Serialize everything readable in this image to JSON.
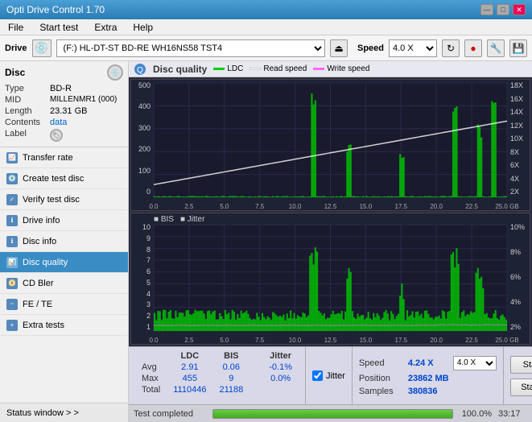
{
  "titleBar": {
    "title": "Opti Drive Control 1.70",
    "minBtn": "—",
    "maxBtn": "□",
    "closeBtn": "✕"
  },
  "menuBar": {
    "items": [
      "File",
      "Start test",
      "Extra",
      "Help"
    ]
  },
  "toolbar": {
    "driveLabel": "Drive",
    "driveName": "(F:)  HL-DT-ST BD-RE  WH16NS58 TST4",
    "speedLabel": "Speed",
    "speedValue": "4.0 X"
  },
  "disc": {
    "label": "Disc",
    "type": {
      "key": "Type",
      "val": "BD-R"
    },
    "mid": {
      "key": "MID",
      "val": "MILLENMR1 (000)"
    },
    "length": {
      "key": "Length",
      "val": "23.31 GB"
    },
    "contents": {
      "key": "Contents",
      "val": "data"
    },
    "labelField": {
      "key": "Label",
      "val": ""
    }
  },
  "navItems": [
    {
      "id": "transfer-rate",
      "label": "Transfer rate",
      "active": false
    },
    {
      "id": "create-test-disc",
      "label": "Create test disc",
      "active": false
    },
    {
      "id": "verify-test-disc",
      "label": "Verify test disc",
      "active": false
    },
    {
      "id": "drive-info",
      "label": "Drive info",
      "active": false
    },
    {
      "id": "disc-info",
      "label": "Disc info",
      "active": false
    },
    {
      "id": "disc-quality",
      "label": "Disc quality",
      "active": true
    },
    {
      "id": "cd-bler",
      "label": "CD Bler",
      "active": false
    },
    {
      "id": "fe-te",
      "label": "FE / TE",
      "active": false
    },
    {
      "id": "extra-tests",
      "label": "Extra tests",
      "active": false
    }
  ],
  "statusWindowBtn": "Status window > >",
  "discQuality": {
    "title": "Disc quality",
    "legend": [
      {
        "id": "ldc",
        "label": "LDC",
        "color": "#00cc00"
      },
      {
        "id": "read-speed",
        "label": "Read speed",
        "color": "#ffffff"
      },
      {
        "id": "write-speed",
        "label": "Write speed",
        "color": "#ff44ff"
      }
    ],
    "chart1": {
      "yAxisLeft": [
        "500",
        "400",
        "300",
        "200",
        "100",
        "0"
      ],
      "yAxisRight": [
        "18X",
        "16X",
        "14X",
        "12X",
        "10X",
        "8X",
        "6X",
        "4X",
        "2X"
      ],
      "xAxisLabels": [
        "0.0",
        "2.5",
        "5.0",
        "7.5",
        "10.0",
        "12.5",
        "15.0",
        "17.5",
        "20.0",
        "22.5",
        "25.0 GB"
      ]
    },
    "chart2": {
      "title": "BIS",
      "legend2": [
        {
          "id": "bis",
          "label": "BIS",
          "color": "#00cc00"
        },
        {
          "id": "jitter",
          "label": "Jitter",
          "color": "#cccccc"
        }
      ],
      "yAxisLeft": [
        "10",
        "9",
        "8",
        "7",
        "6",
        "5",
        "4",
        "3",
        "2",
        "1"
      ],
      "yAxisRight": [
        "10%",
        "8%",
        "6%",
        "4%",
        "2%"
      ],
      "xAxisLabels": [
        "0.0",
        "2.5",
        "5.0",
        "7.5",
        "10.0",
        "12.5",
        "15.0",
        "17.5",
        "20.0",
        "22.5",
        "25.0 GB"
      ]
    }
  },
  "stats": {
    "headers": [
      "",
      "LDC",
      "BIS",
      "",
      "Jitter"
    ],
    "avg": {
      "label": "Avg",
      "ldc": "2.91",
      "bis": "0.06",
      "jitter": "-0.1%"
    },
    "max": {
      "label": "Max",
      "ldc": "455",
      "bis": "9",
      "jitter": "0.0%"
    },
    "total": {
      "label": "Total",
      "ldc": "1110446",
      "bis": "21188",
      "jitter": ""
    },
    "jitterChecked": true,
    "speed": {
      "label": "Speed",
      "value": "4.24 X",
      "select": "4.0 X"
    },
    "position": {
      "label": "Position",
      "value": "23862 MB"
    },
    "samples": {
      "label": "Samples",
      "value": "380836"
    }
  },
  "buttons": {
    "startFull": "Start full",
    "startPart": "Start part"
  },
  "progressBar": {
    "percent": 100,
    "percentText": "100.0%",
    "time": "33:17"
  },
  "statusBar": {
    "text": "Test completed"
  }
}
